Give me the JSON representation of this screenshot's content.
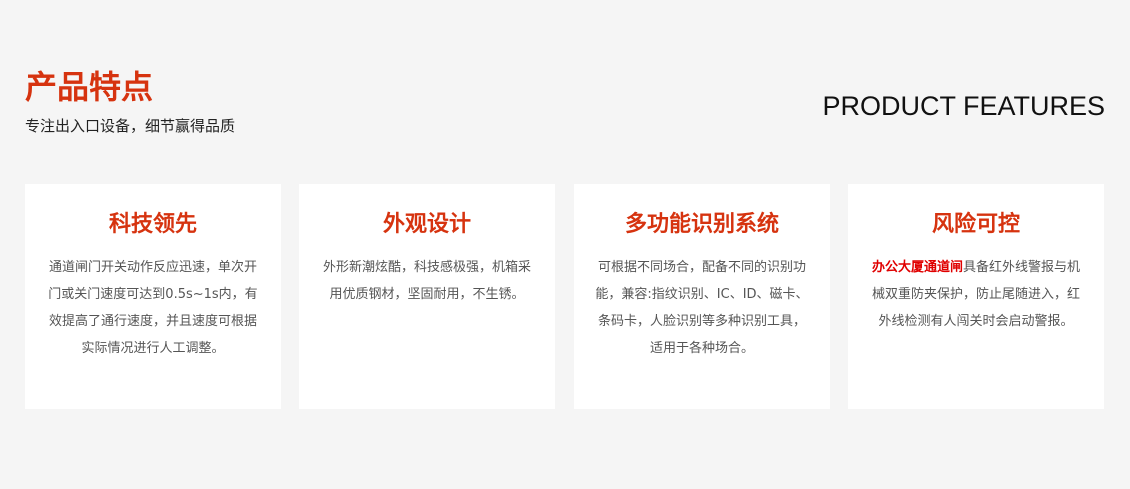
{
  "header": {
    "title": "产品特点",
    "subtitle": "专注出入口设备，细节赢得品质",
    "en_title": "PRODUCT FEATURES"
  },
  "features": [
    {
      "title": "科技领先",
      "desc": "通道闸门开关动作反应迅速，单次开门或关门速度可达到0.5s~1s内，有效提高了通行速度，并且速度可根据实际情况进行人工调整。"
    },
    {
      "title": "外观设计",
      "desc": "外形新潮炫酷，科技感极强，机箱采用优质钢材，坚固耐用，不生锈。"
    },
    {
      "title": "多功能识别系统",
      "desc": "可根据不同场合，配备不同的识别功能，兼容:指纹识别、IC、ID、磁卡、条码卡，人脸识别等多种识别工具，适用于各种场合。"
    },
    {
      "title": "风险可控",
      "desc_link": "办公大厦通道闸",
      "desc": "具备红外线警报与机械双重防夹保护，防止尾随进入，红外线检测有人闯关时会启动警报。"
    }
  ],
  "colors": {
    "accent": "#d6330f",
    "link": "#e00000",
    "background": "#f5f5f5",
    "card": "#ffffff"
  }
}
